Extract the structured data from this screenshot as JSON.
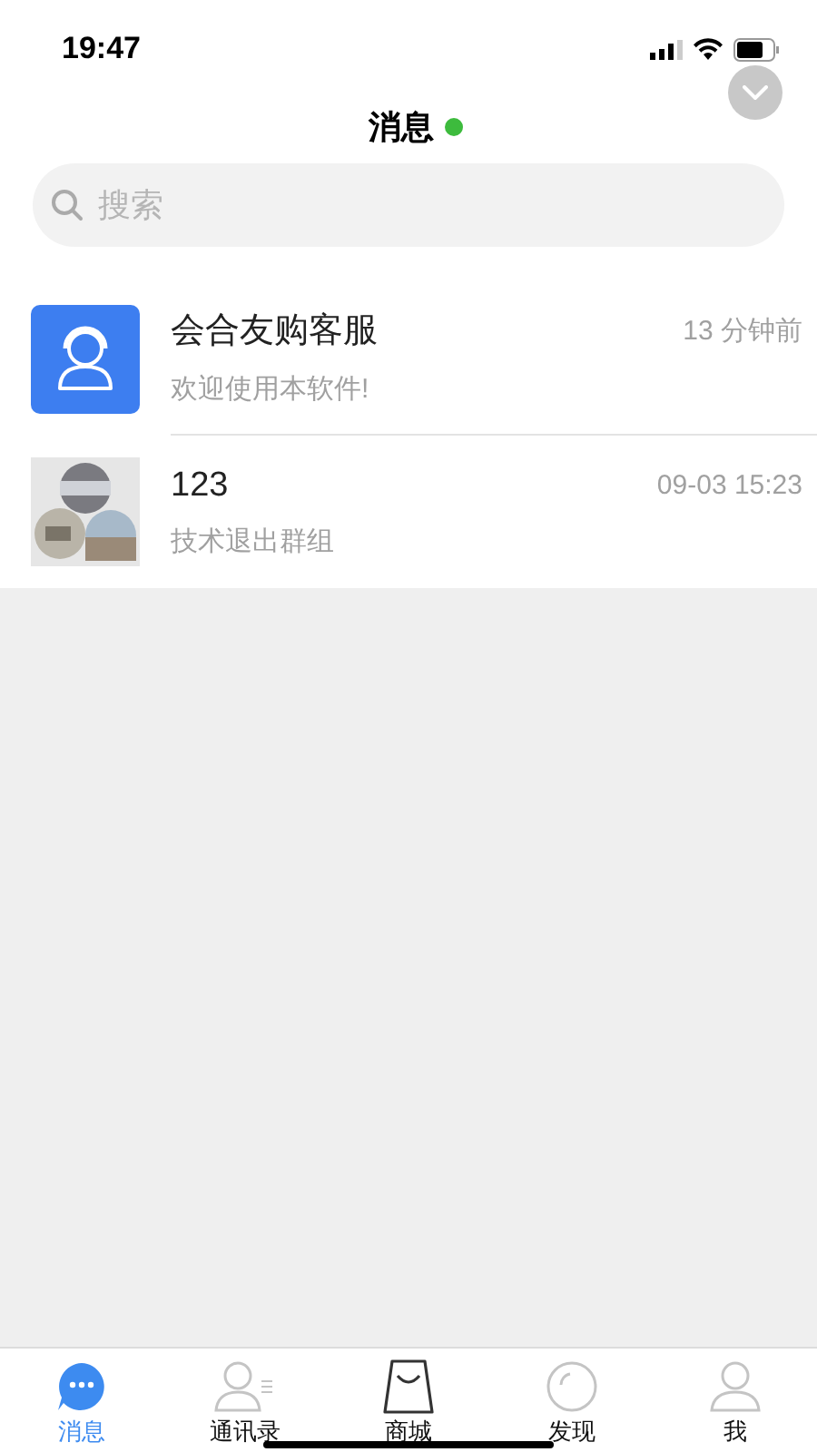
{
  "status_bar": {
    "time": "19:47"
  },
  "header": {
    "title": "消息",
    "online": true
  },
  "search": {
    "placeholder": "搜索"
  },
  "conversations": [
    {
      "kind": "service",
      "name": "会合友购客服",
      "time": "13 分钟前",
      "preview": "欢迎使用本软件!"
    },
    {
      "kind": "group",
      "name": "123",
      "time": "09-03 15:23",
      "preview": "技术退出群组"
    }
  ],
  "tabs": [
    {
      "kind": "chat",
      "label": "消息",
      "selected": true
    },
    {
      "kind": "contacts",
      "label": "通讯录",
      "selected": false
    },
    {
      "kind": "mall",
      "label": "商城",
      "selected": false
    },
    {
      "kind": "discover",
      "label": "发现",
      "selected": false
    },
    {
      "kind": "me",
      "label": "我",
      "selected": false
    }
  ]
}
